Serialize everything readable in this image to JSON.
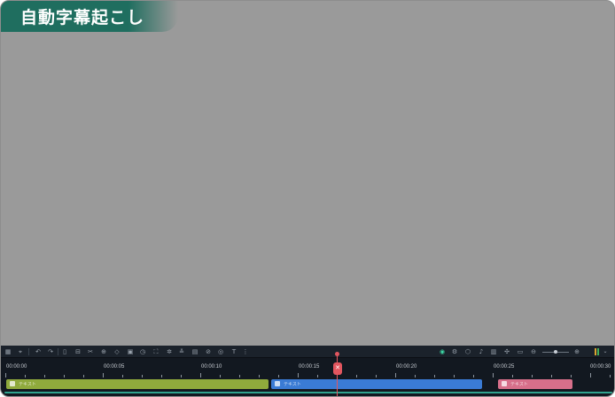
{
  "title": "自動字幕起こし",
  "timeline": {
    "time_labels": [
      "00:00:00",
      "00:00:05",
      "00:00:10",
      "00:00:15",
      "00:00:20",
      "00:00:25",
      "00:00:30"
    ],
    "playhead_time": "00:00:15",
    "clips": [
      {
        "label": "テキスト",
        "color": "#8faa3c"
      },
      {
        "label": "テキスト",
        "color": "#3a7bd5"
      },
      {
        "label": "テキスト",
        "color": "#d76f8a"
      }
    ]
  },
  "toolbar": {
    "left_icons": [
      "grid-icon",
      "magnet-icon",
      "undo-icon",
      "redo-icon",
      "delete-icon",
      "split-icon",
      "cut-icon",
      "zoom-in-icon",
      "crop-icon",
      "color-icon",
      "speed-icon",
      "fullscreen-icon",
      "freeze-icon",
      "audio-icon",
      "text-icon",
      "mask-icon",
      "motion-icon",
      "ai-icon",
      "title-icon"
    ],
    "right_icons": [
      "render-icon",
      "settings-icon",
      "shield-icon",
      "mic-icon",
      "voiceover-icon",
      "snapshot-icon",
      "track-icon",
      "zoom-out-icon",
      "zoom-slider",
      "zoom-add-icon",
      "audio-meter"
    ]
  },
  "colors": {
    "banner": "#1f6e5f",
    "preview_bg": "#9a9a9a",
    "playhead": "#e2565f",
    "accent_line": "#2fa38e"
  }
}
